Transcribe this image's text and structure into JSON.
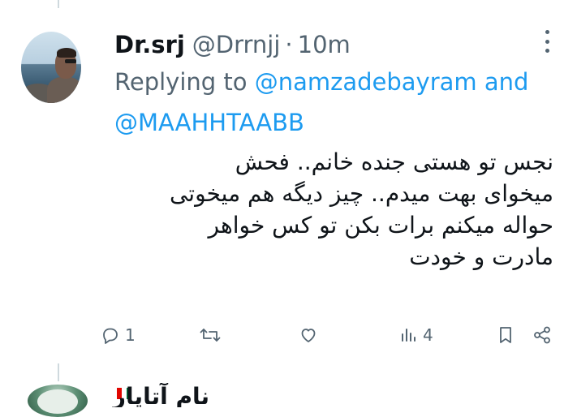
{
  "tweet": {
    "display_name": "Dr.srj",
    "handle": "@Drrnjj",
    "separator": "·",
    "time": "10m",
    "reply_prefix": "Replying to",
    "reply_mention_1": "@namzadebayram and",
    "reply_mention_2": "@MAAHHTAABB",
    "text_lines": [
      "نجس تو هستی جنده خانم.. فحش",
      "میخوای بهت میدم.. چیز دیگه هم میخوتی",
      "حواله میکنم برات بکن تو کس خواهر",
      "مادرت و خودت"
    ]
  },
  "actions": {
    "reply_count": "1",
    "retweet_count": "",
    "like_count": "",
    "views_count": "4"
  },
  "icons": {
    "more": "more-icon",
    "reply": "reply-icon",
    "retweet": "retweet-icon",
    "like": "like-icon",
    "views": "views-icon",
    "bookmark": "bookmark-icon",
    "share": "share-icon"
  },
  "colors": {
    "text": "#0f1419",
    "secondary": "#536471",
    "accent": "#1d9bf0",
    "divider": "#cfd9de"
  },
  "next_tweet": {
    "display_name_partial": "نام آتاپار"
  }
}
